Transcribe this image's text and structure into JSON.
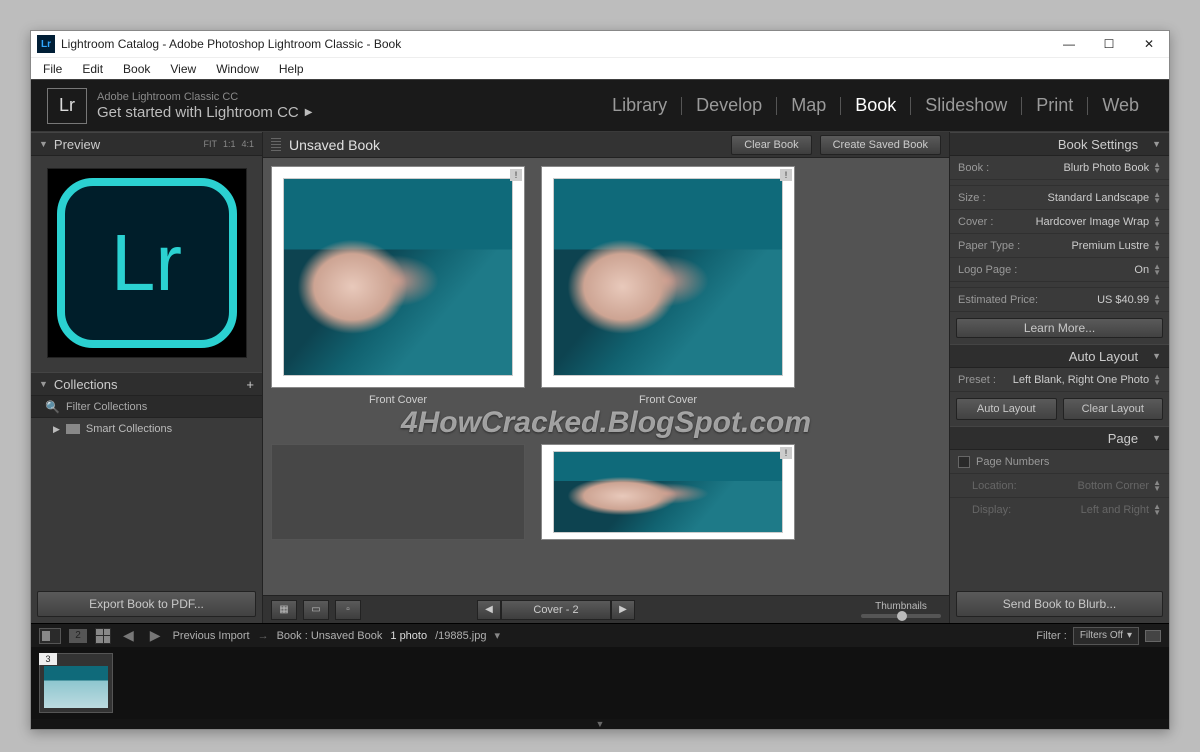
{
  "window": {
    "title": "Lightroom Catalog - Adobe Photoshop Lightroom Classic - Book",
    "icon_text": "Lr"
  },
  "menubar": [
    "File",
    "Edit",
    "Book",
    "View",
    "Window",
    "Help"
  ],
  "header": {
    "logo": "Lr",
    "brand_small": "Adobe Lightroom Classic CC",
    "brand_sub": "Get started with Lightroom CC",
    "modules": [
      "Library",
      "Develop",
      "Map",
      "Book",
      "Slideshow",
      "Print",
      "Web"
    ],
    "active_module": "Book"
  },
  "left_panel": {
    "preview_title": "Preview",
    "preview_zoom": [
      "FIT",
      "1:1",
      "4:1"
    ],
    "collections_title": "Collections",
    "filter_label": "Filter Collections",
    "tree_item": "Smart Collections",
    "export_btn": "Export Book to PDF..."
  },
  "center": {
    "doc_title": "Unsaved Book",
    "clear_btn": "Clear Book",
    "save_btn": "Create Saved Book",
    "page_caption": "Front Cover",
    "pager_label": "Cover - 2",
    "thumbnails_label": "Thumbnails",
    "watermark": "4HowCracked.BlogSpot.com"
  },
  "right_panel": {
    "book_settings_title": "Book Settings",
    "rows": [
      {
        "label": "Book :",
        "value": "Blurb Photo Book"
      },
      {
        "label": "Size :",
        "value": "Standard Landscape"
      },
      {
        "label": "Cover :",
        "value": "Hardcover Image Wrap"
      },
      {
        "label": "Paper Type :",
        "value": "Premium Lustre"
      },
      {
        "label": "Logo Page :",
        "value": "On"
      }
    ],
    "price_label": "Estimated Price:",
    "price_value": "US $40.99",
    "learn_more": "Learn More...",
    "auto_layout_title": "Auto Layout",
    "preset_label": "Preset :",
    "preset_value": "Left Blank, Right One Photo",
    "btn_auto_layout": "Auto Layout",
    "btn_clear_layout": "Clear Layout",
    "page_section_title": "Page",
    "page_numbers_label": "Page Numbers",
    "loc_label": "Location:",
    "loc_value": "Bottom Corner",
    "disp_label": "Display:",
    "disp_value": "Left and Right",
    "send_btn": "Send Book to Blurb..."
  },
  "filmstrip_header": {
    "count_badge": "2",
    "breadcrumb_a": "Previous Import",
    "breadcrumb_b": "Book : Unsaved Book",
    "photo_count": "1 photo",
    "filename": "/19885.jpg",
    "filter_label": "Filter :",
    "filter_value": "Filters Off"
  },
  "filmstrip": {
    "thumb_index": "3"
  }
}
